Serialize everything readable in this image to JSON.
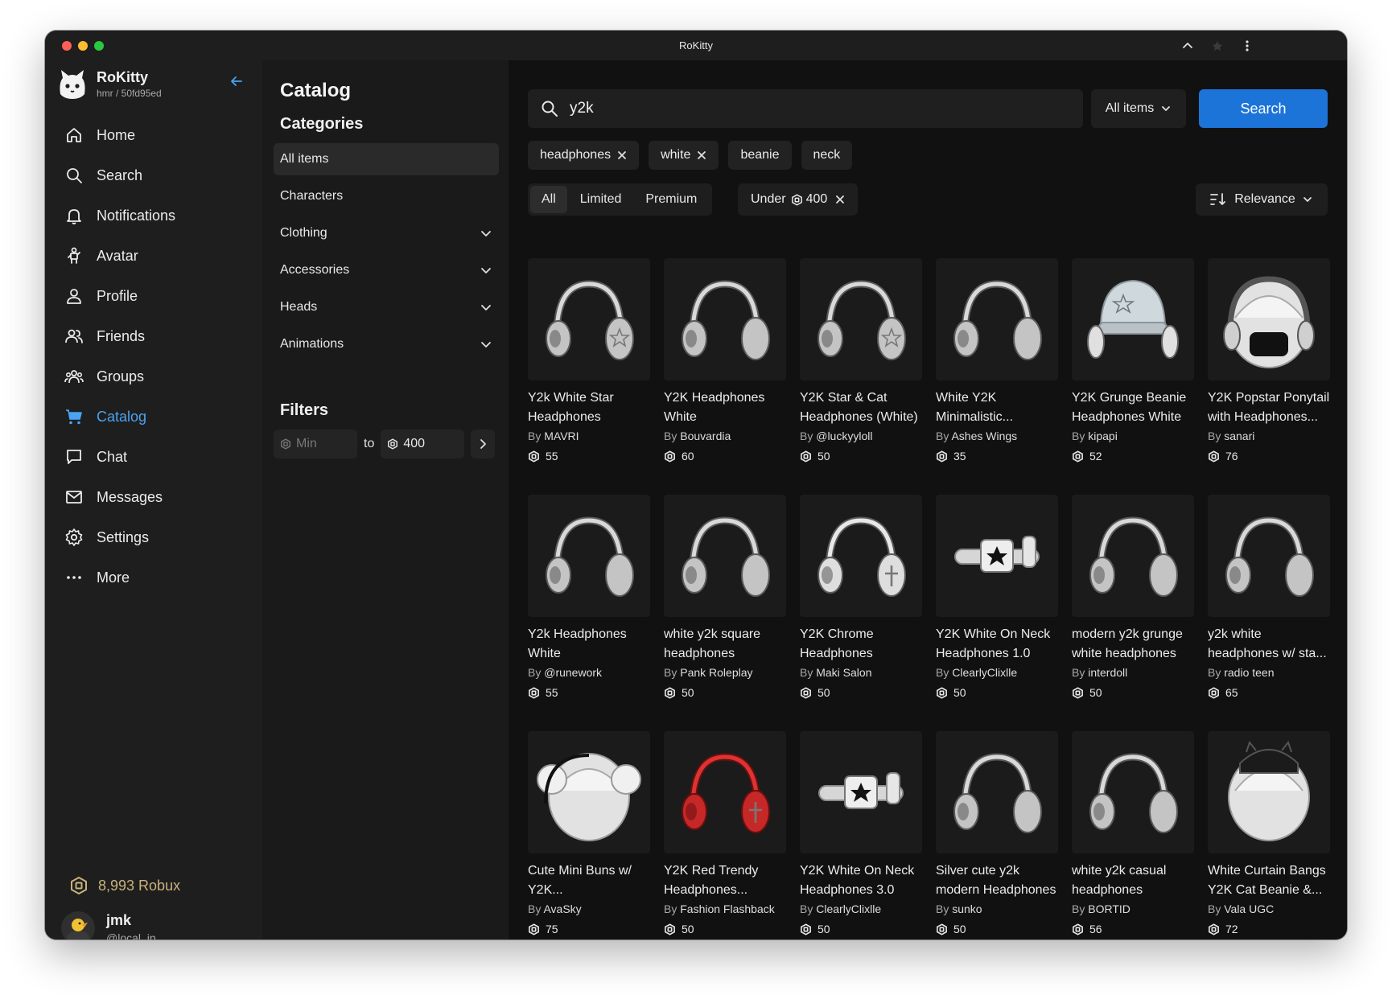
{
  "window": {
    "title": "RoKitty"
  },
  "brand": {
    "name": "RoKitty",
    "sub": "hmr / 50fd95ed"
  },
  "nav": [
    {
      "label": "Home",
      "icon": "home-icon",
      "active": false
    },
    {
      "label": "Search",
      "icon": "search-icon",
      "active": false
    },
    {
      "label": "Notifications",
      "icon": "bell-icon",
      "active": false
    },
    {
      "label": "Avatar",
      "icon": "avatar-icon",
      "active": false
    },
    {
      "label": "Profile",
      "icon": "user-icon",
      "active": false
    },
    {
      "label": "Friends",
      "icon": "friends-icon",
      "active": false
    },
    {
      "label": "Groups",
      "icon": "groups-icon",
      "active": false
    },
    {
      "label": "Catalog",
      "icon": "cart-icon",
      "active": true
    },
    {
      "label": "Chat",
      "icon": "chat-icon",
      "active": false
    },
    {
      "label": "Messages",
      "icon": "mail-icon",
      "active": false
    },
    {
      "label": "Settings",
      "icon": "gear-icon",
      "active": false
    },
    {
      "label": "More",
      "icon": "more-icon",
      "active": false
    }
  ],
  "robux": {
    "label": "8,993 Robux"
  },
  "user": {
    "name": "jmk",
    "handle": "@local_ip"
  },
  "catalog": {
    "title": "Catalog",
    "categories_title": "Categories",
    "categories": [
      {
        "label": "All items",
        "expandable": false,
        "active": true
      },
      {
        "label": "Characters",
        "expandable": false,
        "active": false
      },
      {
        "label": "Clothing",
        "expandable": true,
        "active": false
      },
      {
        "label": "Accessories",
        "expandable": true,
        "active": false
      },
      {
        "label": "Heads",
        "expandable": true,
        "active": false
      },
      {
        "label": "Animations",
        "expandable": true,
        "active": false
      }
    ],
    "filters_title": "Filters",
    "price": {
      "min_placeholder": "Min",
      "to": "to",
      "max": "400"
    }
  },
  "search": {
    "query": "y2k",
    "scope": "All items",
    "button": "Search"
  },
  "tags": [
    {
      "label": "headphones",
      "removable": true
    },
    {
      "label": "white",
      "removable": true
    },
    {
      "label": "beanie",
      "removable": false
    },
    {
      "label": "neck",
      "removable": false
    }
  ],
  "type_filter": {
    "options": [
      "All",
      "Limited",
      "Premium"
    ],
    "selected": "All"
  },
  "price_chip": {
    "prefix": "Under",
    "value": "400"
  },
  "sort": {
    "label": "Relevance"
  },
  "colors": {
    "accent": "#1d74d8",
    "active_nav": "#4aa3f0",
    "robux": "#c8b27c"
  },
  "items": [
    {
      "name": "Y2k White Star Headphones",
      "creator": "MAVRI",
      "price": "55",
      "icon": "headphones-star-icon"
    },
    {
      "name": "Y2K Headphones White",
      "creator": "Bouvardia",
      "price": "60",
      "icon": "headphones-icon"
    },
    {
      "name": "Y2K Star & Cat Headphones (White)",
      "creator": "@luckyyloll",
      "price": "50",
      "icon": "headphones-star-icon"
    },
    {
      "name": "White Y2K Minimalistic...",
      "creator": "Ashes Wings",
      "price": "35",
      "icon": "headphones-icon"
    },
    {
      "name": "Y2K Grunge Beanie Headphones White",
      "creator": "kipapi",
      "price": "52",
      "icon": "beanie-icon"
    },
    {
      "name": "Y2K Popstar Ponytail with Headphones...",
      "creator": "sanari",
      "price": "76",
      "icon": "hair-headphones-icon"
    },
    {
      "name": "Y2k Headphones White",
      "creator": "@runework",
      "price": "55",
      "icon": "headphones-icon"
    },
    {
      "name": "white y2k square headphones",
      "creator": "Pank Roleplay",
      "price": "50",
      "icon": "headphones-icon"
    },
    {
      "name": "Y2K Chrome Headphones",
      "creator": "Maki Salon",
      "price": "50",
      "icon": "headphones-cross-icon"
    },
    {
      "name": "Y2K White On Neck Headphones 1.0",
      "creator": "ClearlyClixlle",
      "price": "50",
      "icon": "neck-headphones-icon"
    },
    {
      "name": "modern y2k grunge white headphones",
      "creator": "interdoll",
      "price": "50",
      "icon": "headphones-icon"
    },
    {
      "name": "y2k white headphones w/ sta...",
      "creator": "radio teen",
      "price": "65",
      "icon": "headphones-icon"
    },
    {
      "name": "Cute Mini Buns w/ Y2K...",
      "creator": "AvaSky",
      "price": "75",
      "icon": "hair-buns-icon"
    },
    {
      "name": "Y2K Red Trendy Headphones...",
      "creator": "Fashion Flashback",
      "price": "50",
      "icon": "headphones-red-icon"
    },
    {
      "name": "Y2K White On Neck Headphones 3.0",
      "creator": "ClearlyClixlle",
      "price": "50",
      "icon": "neck-headphones-icon"
    },
    {
      "name": "Silver cute y2k modern Headphones",
      "creator": "sunko",
      "price": "50",
      "icon": "headphones-icon"
    },
    {
      "name": "white y2k casual headphones",
      "creator": "BORTID",
      "price": "56",
      "icon": "headphones-icon"
    },
    {
      "name": "White Curtain Bangs Y2K Cat Beanie &...",
      "creator": "Vala UGC",
      "price": "72",
      "icon": "hair-beanie-icon"
    }
  ]
}
